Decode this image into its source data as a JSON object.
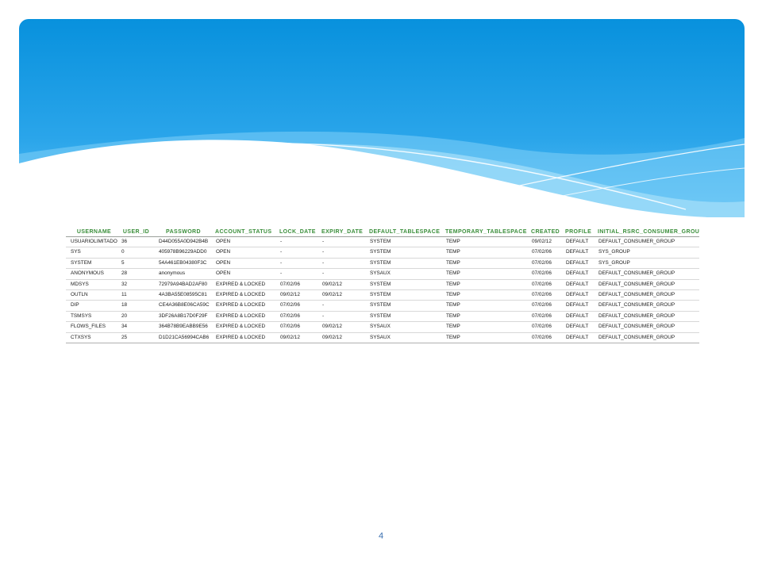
{
  "table": {
    "columns": [
      "USERNAME",
      "USER_ID",
      "PASSWORD",
      "ACCOUNT_STATUS",
      "LOCK_DATE",
      "EXPIRY_DATE",
      "DEFAULT_TABLESPACE",
      "TEMPORARY_TABLESPACE",
      "CREATED",
      "PROFILE",
      "INITIAL_RSRC_CONSUMER_GROUP"
    ],
    "rows": [
      [
        "USUARIOLIMITADO",
        "36",
        "D44D055A0D942B4B",
        "OPEN",
        "-",
        "-",
        "SYSTEM",
        "TEMP",
        "09/02/12",
        "DEFAULT",
        "DEFAULT_CONSUMER_GROUP"
      ],
      [
        "SYS",
        "0",
        "405978B96229ADD0",
        "OPEN",
        "-",
        "-",
        "SYSTEM",
        "TEMP",
        "07/02/06",
        "DEFAULT",
        "SYS_GROUP"
      ],
      [
        "SYSTEM",
        "5",
        "54A461EB04380F3C",
        "OPEN",
        "-",
        "-",
        "SYSTEM",
        "TEMP",
        "07/02/06",
        "DEFAULT",
        "SYS_GROUP"
      ],
      [
        "ANONYMOUS",
        "28",
        "anonymous",
        "OPEN",
        "-",
        "-",
        "SYSAUX",
        "TEMP",
        "07/02/06",
        "DEFAULT",
        "DEFAULT_CONSUMER_GROUP"
      ],
      [
        "MDSYS",
        "32",
        "72979A94BAD2AF80",
        "EXPIRED & LOCKED",
        "07/02/06",
        "09/02/12",
        "SYSTEM",
        "TEMP",
        "07/02/06",
        "DEFAULT",
        "DEFAULT_CONSUMER_GROUP"
      ],
      [
        "OUTLN",
        "11",
        "4A3BA55E08595C81",
        "EXPIRED & LOCKED",
        "09/02/12",
        "09/02/12",
        "SYSTEM",
        "TEMP",
        "07/02/06",
        "DEFAULT",
        "DEFAULT_CONSUMER_GROUP"
      ],
      [
        "DIP",
        "18",
        "CE4A36B8E06CA59C",
        "EXPIRED & LOCKED",
        "07/02/06",
        "-",
        "SYSTEM",
        "TEMP",
        "07/02/06",
        "DEFAULT",
        "DEFAULT_CONSUMER_GROUP"
      ],
      [
        "TSMSYS",
        "20",
        "3DF26A8B17D0F29F",
        "EXPIRED & LOCKED",
        "07/02/06",
        "-",
        "SYSTEM",
        "TEMP",
        "07/02/06",
        "DEFAULT",
        "DEFAULT_CONSUMER_GROUP"
      ],
      [
        "FLOWS_FILES",
        "34",
        "364B78B9EABB9E56",
        "EXPIRED & LOCKED",
        "07/02/06",
        "09/02/12",
        "SYSAUX",
        "TEMP",
        "07/02/06",
        "DEFAULT",
        "DEFAULT_CONSUMER_GROUP"
      ],
      [
        "CTXSYS",
        "25",
        "D1D21CA56994CAB6",
        "EXPIRED & LOCKED",
        "09/02/12",
        "09/02/12",
        "SYSAUX",
        "TEMP",
        "07/02/06",
        "DEFAULT",
        "DEFAULT_CONSUMER_GROUP"
      ]
    ]
  },
  "page_number": "4",
  "colors": {
    "header_text": "#3a8e3a",
    "banner_top": "#0b8fdc",
    "banner_bottom": "#61c2f5",
    "page_number": "#3a6fb0"
  }
}
